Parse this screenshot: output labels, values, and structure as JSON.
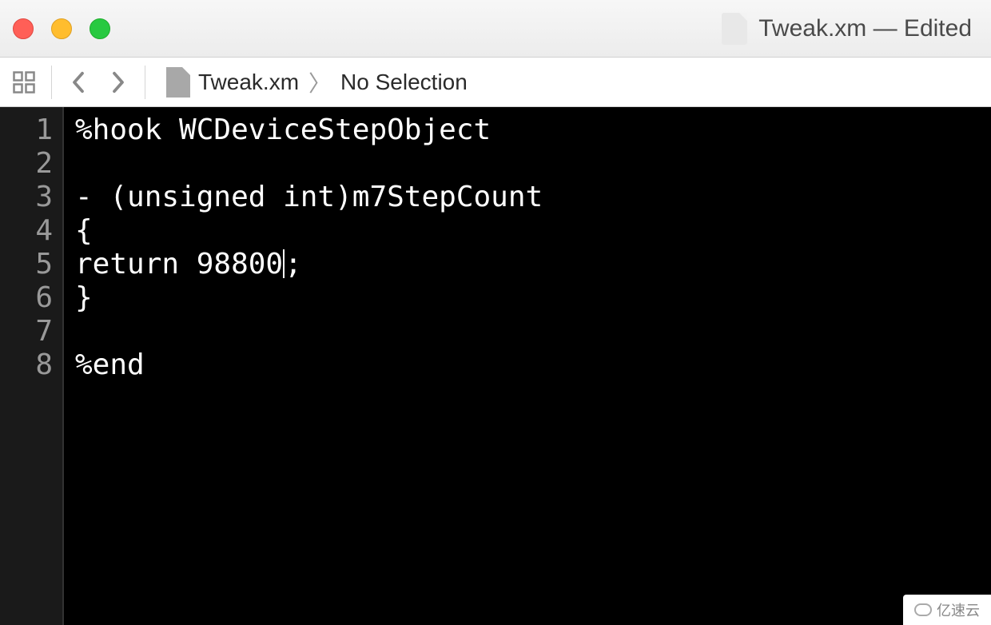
{
  "window": {
    "title": "Tweak.xm — Edited"
  },
  "breadcrumb": {
    "file": "Tweak.xm",
    "selection": "No Selection"
  },
  "editor": {
    "lineNumbers": [
      "1",
      "2",
      "3",
      "4",
      "5",
      "6",
      "7",
      "8"
    ],
    "lines": [
      "%hook WCDeviceStepObject",
      "",
      "- (unsigned int)m7StepCount",
      "{",
      "return 98800;",
      "}",
      "",
      "%end"
    ],
    "cursorLine": 4,
    "cursorCol": 12
  },
  "watermark": {
    "text": "亿速云"
  }
}
